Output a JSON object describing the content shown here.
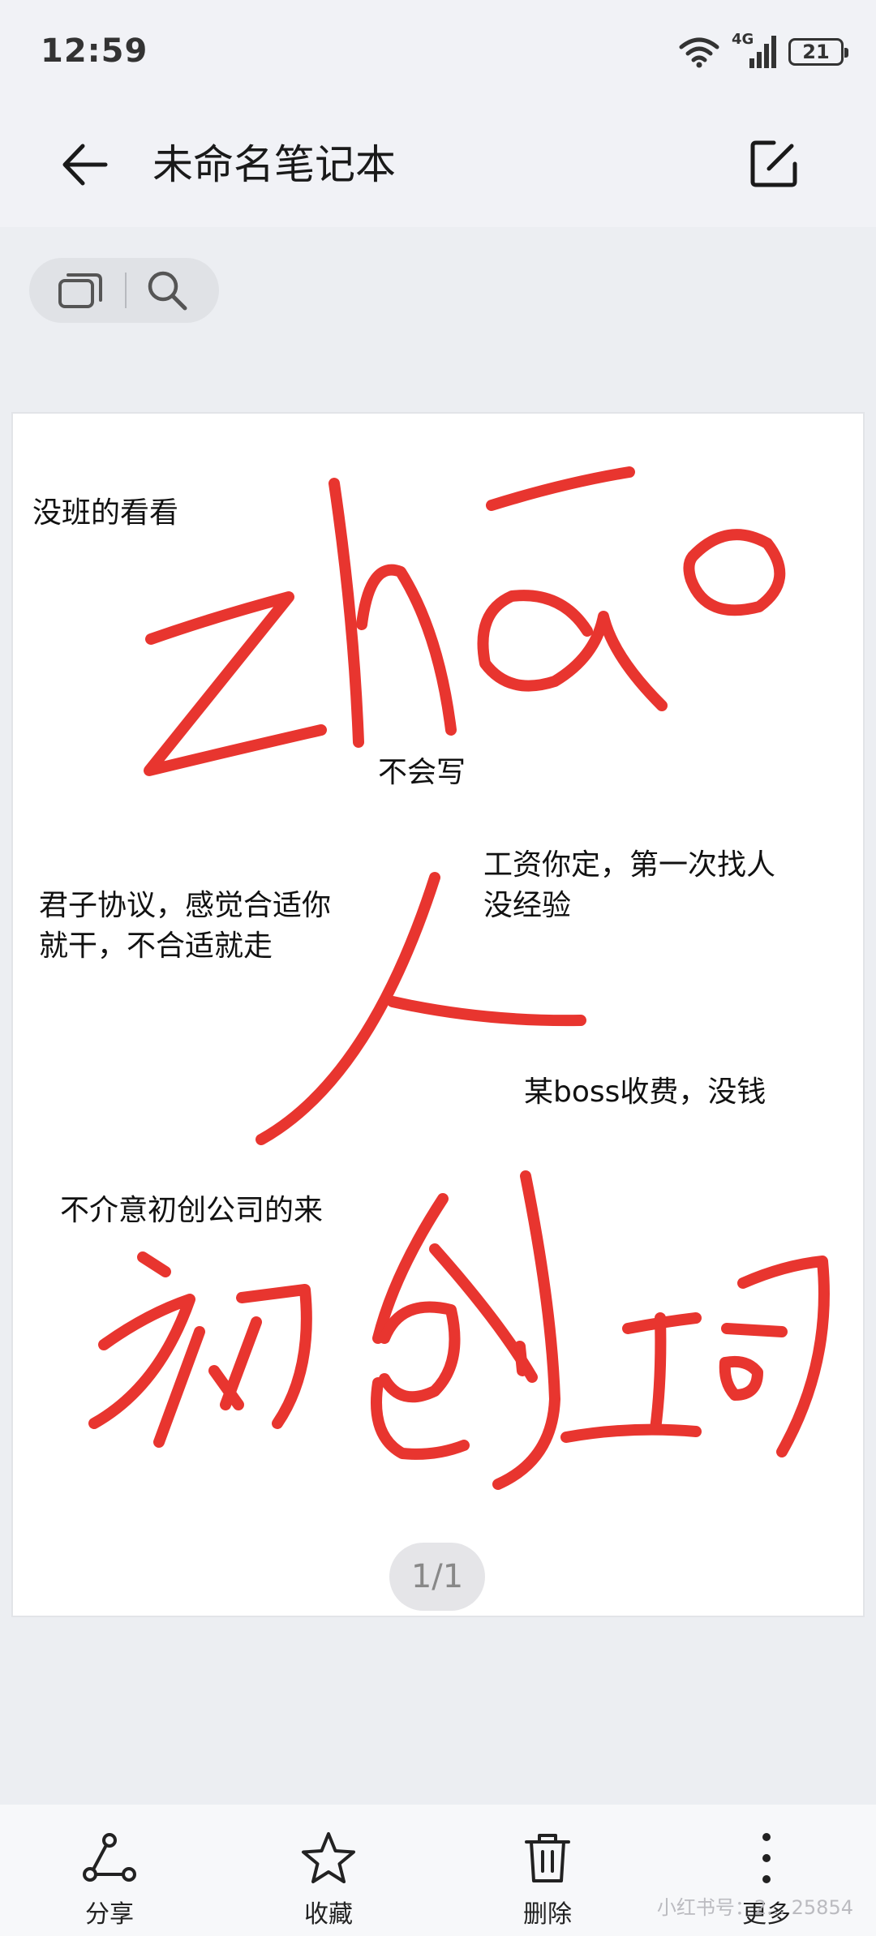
{
  "status_bar": {
    "time": "12:59",
    "network": "4G",
    "battery": "21"
  },
  "header": {
    "title": "未命名笔记本",
    "back_icon": "back-arrow-icon",
    "edit_icon": "edit-icon"
  },
  "toolbar": {
    "pages_icon": "pages-icon",
    "search_icon": "search-icon"
  },
  "note": {
    "texts": [
      "没班的看看",
      "不会写",
      "工资你定，第一次找人\n没经验",
      "君子协议，感觉合适你\n就干，不合适就走",
      "某boss收费，没钱",
      "不介意初创公司的来"
    ],
    "ink_color": "#e8352f",
    "page_indicator": "1/1"
  },
  "bottom_bar": {
    "items": [
      {
        "label": "分享",
        "icon": "share-icon"
      },
      {
        "label": "收藏",
        "icon": "star-icon"
      },
      {
        "label": "删除",
        "icon": "trash-icon"
      },
      {
        "label": "更多",
        "icon": "more-vertical-icon"
      }
    ]
  },
  "watermark": "小红书号：2... 25854"
}
